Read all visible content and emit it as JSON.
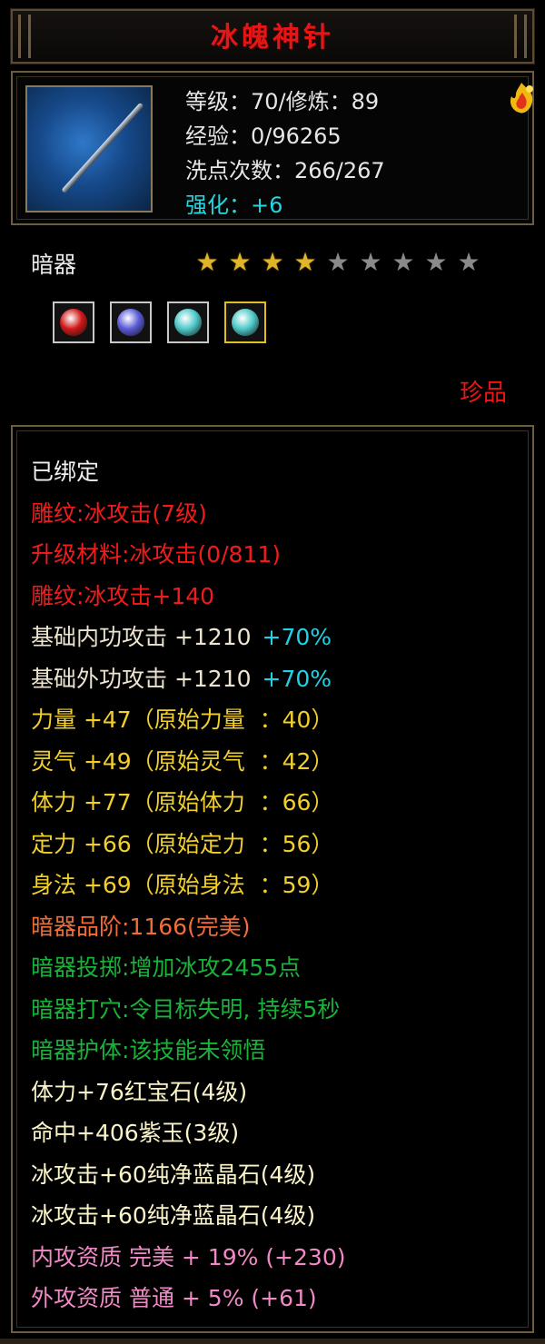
{
  "title": "冰魄神针",
  "item": {
    "icon": "needle-weapon-icon",
    "level_line": "等级：70/修炼：89",
    "exp_line": "经验：0/96265",
    "wash_line": "洗点次数：266/267",
    "enhance_line": "强化：+6",
    "badge_icon": "flame-gem-badge-icon"
  },
  "type_label": "暗器",
  "stars": {
    "filled": 4,
    "total": 9
  },
  "slots": [
    {
      "icon": "red-gem-icon",
      "color": "#d01818",
      "selected": false
    },
    {
      "icon": "purple-gem-icon",
      "color": "#5a5ad8",
      "selected": false
    },
    {
      "icon": "blue-crystal-icon",
      "color": "#4ec9c9",
      "selected": false
    },
    {
      "icon": "blue-crystal-icon",
      "color": "#4ec9c9",
      "selected": true
    }
  ],
  "quality": "珍品",
  "attributes": [
    {
      "text": "已绑定",
      "color": "white"
    },
    {
      "text": "雕纹:冰攻击(7级)",
      "color": "red"
    },
    {
      "text": "升级材料:冰攻击(0/811)",
      "color": "red"
    },
    {
      "text": "雕纹:冰攻击+140",
      "color": "red"
    },
    {
      "text": "基础内功攻击 +1210",
      "pct": "+70%",
      "color": "beige"
    },
    {
      "text": "基础外功攻击 +1210",
      "pct": "+70%",
      "color": "beige"
    },
    {
      "text": "力量 +47（原始力量  ：40）",
      "color": "yellow"
    },
    {
      "text": "灵气 +49（原始灵气  ：42）",
      "color": "yellow"
    },
    {
      "text": "体力 +77（原始体力  ：66）",
      "color": "yellow"
    },
    {
      "text": "定力 +66（原始定力  ：56）",
      "color": "yellow"
    },
    {
      "text": "身法 +69（原始身法  ：59）",
      "color": "yellow"
    },
    {
      "text": "暗器品阶:1166(完美)",
      "color": "orange"
    },
    {
      "text": "暗器投掷:增加冰攻2455点",
      "color": "green"
    },
    {
      "text": "暗器打穴:令目标失明, 持续5秒",
      "color": "green"
    },
    {
      "text": "暗器护体:该技能未领悟",
      "color": "green"
    },
    {
      "text": "体力+76红宝石(4级)",
      "color": "ivory"
    },
    {
      "text": "命中+406紫玉(3级)",
      "color": "ivory"
    },
    {
      "text": "冰攻击+60纯净蓝晶石(4级)",
      "color": "ivory"
    },
    {
      "text": "冰攻击+60纯净蓝晶石(4级)",
      "color": "ivory"
    },
    {
      "text": "内攻资质 完美 + 19% (+230)",
      "color": "pink"
    },
    {
      "text": "外攻资质 普通 + 5% (+61)",
      "color": "pink"
    }
  ]
}
